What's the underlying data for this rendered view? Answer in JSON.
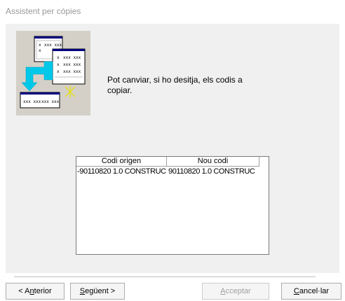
{
  "window": {
    "title": "Assistent per còpies"
  },
  "message": "Pot canviar, si ho desitja, els codis a copiar.",
  "table": {
    "columns": [
      "Codi origen",
      "Nou codi"
    ],
    "rows": [
      [
        "-90110820 1.0 CONSTRUC",
        "90110820 1.0 CONSTRUC"
      ]
    ]
  },
  "buttons": {
    "anterior": {
      "pre": "< A",
      "mnemonic": "n",
      "post": "terior"
    },
    "seguent": {
      "pre": "",
      "mnemonic": "S",
      "post": "egüent >"
    },
    "acceptar": {
      "pre": "",
      "mnemonic": "A",
      "post": "cceptar"
    },
    "cancel": {
      "pre": "",
      "mnemonic": "C",
      "post": "ancel·lar"
    }
  },
  "illustration": {
    "icon": "copy-wizard-icon",
    "cell_text": "x",
    "code_text": "xxx xxx"
  },
  "colors": {
    "accent": "#00c8e8",
    "panel": "#f0f0f0",
    "window_navy": "#000080"
  }
}
